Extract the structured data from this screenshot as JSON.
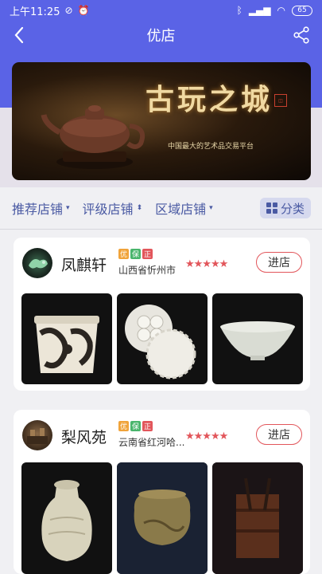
{
  "status_bar": {
    "time": "上午11:25",
    "battery": "65"
  },
  "nav": {
    "title": "优店"
  },
  "banner": {
    "title": "古玩之城",
    "subtitle": "中国最大的艺术品交易平台"
  },
  "filters": [
    {
      "label": "推荐店铺",
      "arrow": "▾"
    },
    {
      "label": "评级店铺",
      "arrow": "⬍"
    },
    {
      "label": "区域店铺",
      "arrow": "▾"
    }
  ],
  "category_button": {
    "label": "分类"
  },
  "shops": [
    {
      "name": "凤麒轩",
      "badges": [
        {
          "text": "优",
          "color": "#f0a33a"
        },
        {
          "text": "保",
          "color": "#49b56c"
        },
        {
          "text": "正",
          "color": "#e2565b"
        }
      ],
      "location": "山西省忻州市",
      "stars": "★★★★★",
      "enter_label": "进店"
    },
    {
      "name": "梨风苑",
      "badges": [
        {
          "text": "优",
          "color": "#f0a33a"
        },
        {
          "text": "保",
          "color": "#49b56c"
        },
        {
          "text": "正",
          "color": "#e2565b"
        }
      ],
      "location": "云南省红河哈...",
      "stars": "★★★★★",
      "enter_label": "进店"
    }
  ],
  "colors": {
    "primary": "#5a63e6",
    "accent_red": "#e2565b",
    "filter_text": "#4a5aa3"
  }
}
